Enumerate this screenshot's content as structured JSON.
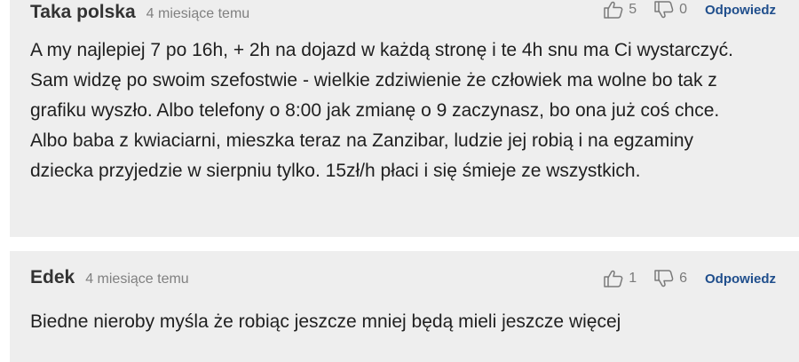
{
  "comments": [
    {
      "author": "Taka polska",
      "time": "4 miesiące temu",
      "likes": "5",
      "dislikes": "0",
      "reply_label": "Odpowiedz",
      "text": "A my najlepiej 7 po 16h, + 2h na dojazd w każdą stronę i te 4h snu ma Ci wystarczyć. Sam widzę po swoim szefostwie - wielkie zdziwienie że człowiek ma wolne bo tak z grafiku wyszło. Albo telefony o 8:00 jak zmianę o 9 zaczynasz, bo ona już coś chce. Albo baba z kwiaciarni, mieszka teraz na Zanzibar, ludzie jej robią i na egzaminy dziecka przyjedzie w sierpniu tylko. 15zł/h płaci i się śmieje ze wszystkich."
    },
    {
      "author": "Edek",
      "time": "4 miesiące temu",
      "likes": "1",
      "dislikes": "6",
      "reply_label": "Odpowiedz",
      "text": "Biedne nieroby myśla że robiąc jeszcze mniej będą mieli jeszcze więcej"
    }
  ],
  "icons": {
    "like": "thumbs-up-icon",
    "dislike": "thumbs-down-icon"
  },
  "colors": {
    "card_background": "#eeeeee",
    "reply_link": "#1f4e8c",
    "meta_text": "#808080"
  }
}
